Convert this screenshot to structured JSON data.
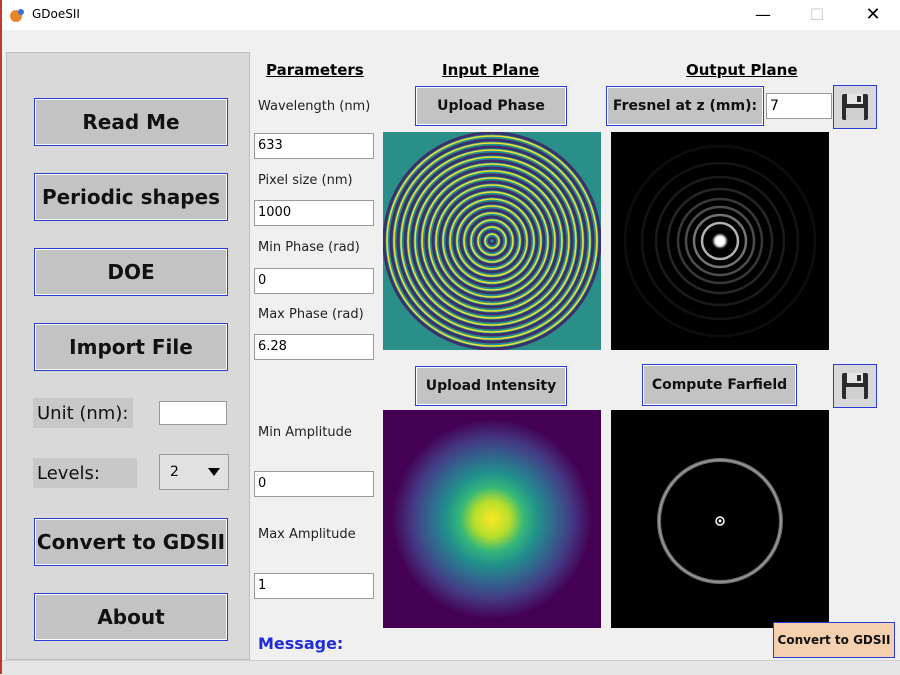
{
  "window": {
    "title": "GDoeSII",
    "minimize": "—",
    "maximize": "☐",
    "close": "✕"
  },
  "left_panel": {
    "buttons": [
      "Read Me",
      "Periodic shapes",
      "DOE",
      "Import File"
    ],
    "unit_label": "Unit (nm):",
    "unit_value": "",
    "levels_label": "Levels:",
    "levels_value": "2",
    "convert_button": "Convert to GDSII",
    "about_button": "About"
  },
  "headers": {
    "parameters": "Parameters",
    "input_plane": "Input Plane",
    "output_plane": "Output Plane"
  },
  "parameters": {
    "wavelength_label": "Wavelength (nm)",
    "wavelength_value": "633",
    "pixel_label": "Pixel size (nm)",
    "pixel_value": "1000",
    "min_phase_label": "Min Phase (rad)",
    "min_phase_value": "0",
    "max_phase_label": "Max Phase (rad)",
    "max_phase_value": "6.28",
    "min_amp_label": "Min Amplitude",
    "min_amp_value": "0",
    "max_amp_label": "Max Amplitude",
    "max_amp_value": "1"
  },
  "input_plane": {
    "upload_phase": "Upload Phase",
    "upload_intensity": "Upload Intensity"
  },
  "output_plane": {
    "fresnel_button": "Fresnel at z (mm):",
    "fresnel_z": "7",
    "compute_farfield": "Compute Farfield"
  },
  "footer": {
    "message_label": "Message:",
    "convert_small": "Convert to GDSII"
  },
  "colors": {
    "button_border": "#2a3bd6",
    "message_blue": "#1f2cd8",
    "accent_orange": "#f5d0ae",
    "phase_bg": "#2a8f88"
  }
}
